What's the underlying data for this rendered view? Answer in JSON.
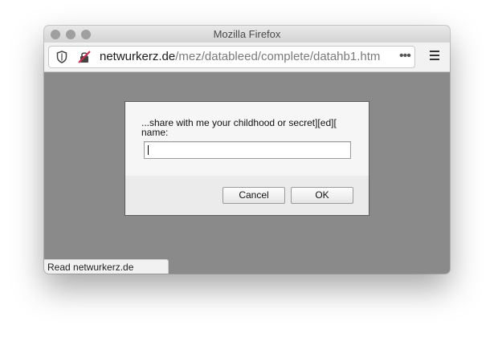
{
  "window": {
    "title": "Mozilla Firefox"
  },
  "toolbar": {
    "url_domain": "netwurkerz.de",
    "url_path": "/mez/datableed/complete/datahb1.htm",
    "page_actions": "•••",
    "tracking_icon": "shield-icon",
    "connection_icon": "insecure-connection-icon",
    "menu_icon": "hamburger-menu-icon"
  },
  "dialog": {
    "prompt_line1": "...share with me your childhood or secret][ed][",
    "prompt_line2": "name:",
    "input_value": "",
    "cancel_label": "Cancel",
    "ok_label": "OK"
  },
  "status": {
    "text": "Read netwurkerz.de"
  },
  "colors": {
    "content_background": "#8a8a8a",
    "insecure_icon": "#d7264a"
  }
}
